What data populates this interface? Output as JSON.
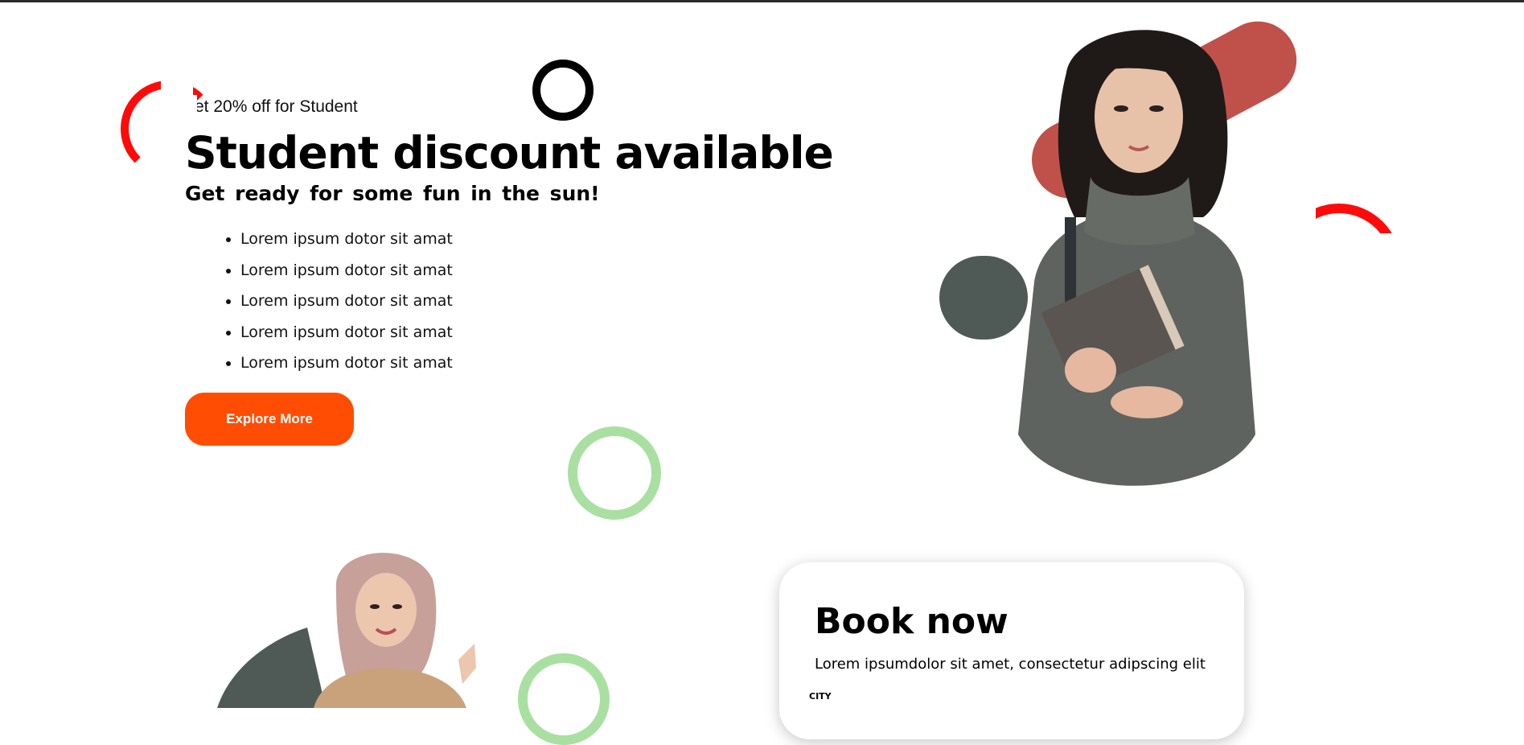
{
  "hero": {
    "eyebrow": "et 20% off for Student",
    "title": "Student discount available",
    "subtitle": "Get ready for some fun in the sun!",
    "features": [
      "Lorem ipsum dotor sit amat",
      "Lorem ipsum dotor sit amat",
      "Lorem ipsum dotor sit amat",
      "Lorem ipsum dotor sit amat",
      "Lorem ipsum dotor sit amat"
    ],
    "cta_label": "Explore More"
  },
  "booking": {
    "title": "Book now",
    "description": "Lorem ipsumdolor sit amet, consectetur adipscing elit",
    "field_label": "CITY"
  },
  "colors": {
    "accent": "#ff4d04",
    "decor_red": "#ff0a0a",
    "decor_green": "#a9e0a2",
    "blob_red": "#c0514a",
    "blob_gray": "#4f5a57"
  }
}
